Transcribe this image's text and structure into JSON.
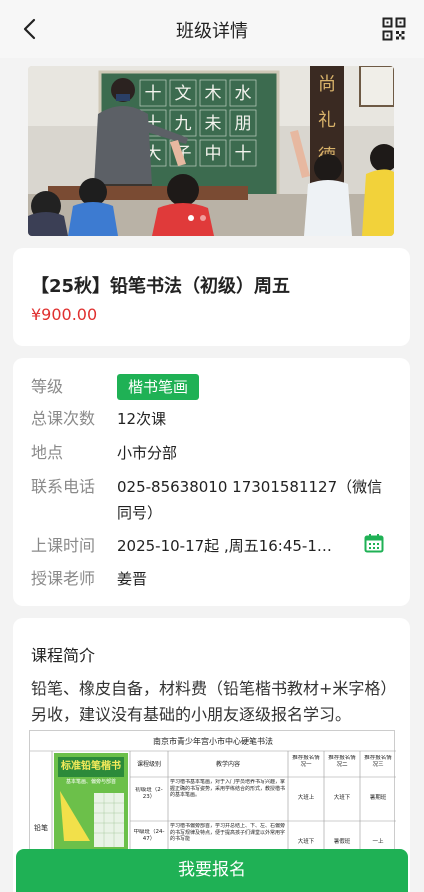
{
  "header": {
    "title": "班级详情"
  },
  "banner": {
    "board_chars": [
      "十",
      "文",
      "木",
      "水",
      "十",
      "九",
      "未",
      "朋",
      "大",
      "子",
      "中",
      "十"
    ],
    "scroll_chars": [
      "尚",
      "礼",
      "德"
    ]
  },
  "course": {
    "title": "【25秋】铅笔书法（初级）周五",
    "price": "¥900.00"
  },
  "info": {
    "level_label": "等级",
    "level_value": "楷书笔画",
    "count_label": "总课次数",
    "count_value": "12次课",
    "place_label": "地点",
    "place_value": "小市分部",
    "phone_label": "联系电话",
    "phone_value": "025-85638010 17301581127（微信同号）",
    "time_label": "上课时间",
    "time_value": "2025-10-17起 ,周五16:45-1…",
    "teacher_label": "授课老师",
    "teacher_value": "姜晋"
  },
  "intro": {
    "heading": "课程简介",
    "text": "铅笔、橡皮自备，材料费（铅笔楷书教材+米字格）另收，建议没有基础的小朋友逐级报名学习。",
    "table": {
      "title": "南京市青少年宫小市中心硬笔书法",
      "book_title": "标准铅笔楷书",
      "book_subtitle": "基本笔画、偏旁与部首",
      "side_label": "铅笔",
      "headers": [
        "课程级别",
        "教学内容",
        "推荐报名情况一",
        "推荐报名情况二",
        "推荐报名情况三"
      ],
      "rows": [
        [
          "初级班（2-23）",
          "学习楷书基本笔画，对于入门学员培养书写兴趣，掌握正确的书写姿势，采用学练结合的形式，教授楷书的基本笔画。",
          "大班上",
          "大班下",
          "暑期班"
        ],
        [
          "中级班（24-47）",
          "学习楷书偏旁部首，学习并总结上、下、左、右偏旁的书写规律及特点，便于提高孩子们课堂以外常用字的书写能",
          "大班下",
          "暑假班",
          "一上"
        ]
      ]
    }
  },
  "cta": {
    "label": "我要报名"
  },
  "colors": {
    "accent": "#1fb155",
    "price": "#e0302f"
  }
}
